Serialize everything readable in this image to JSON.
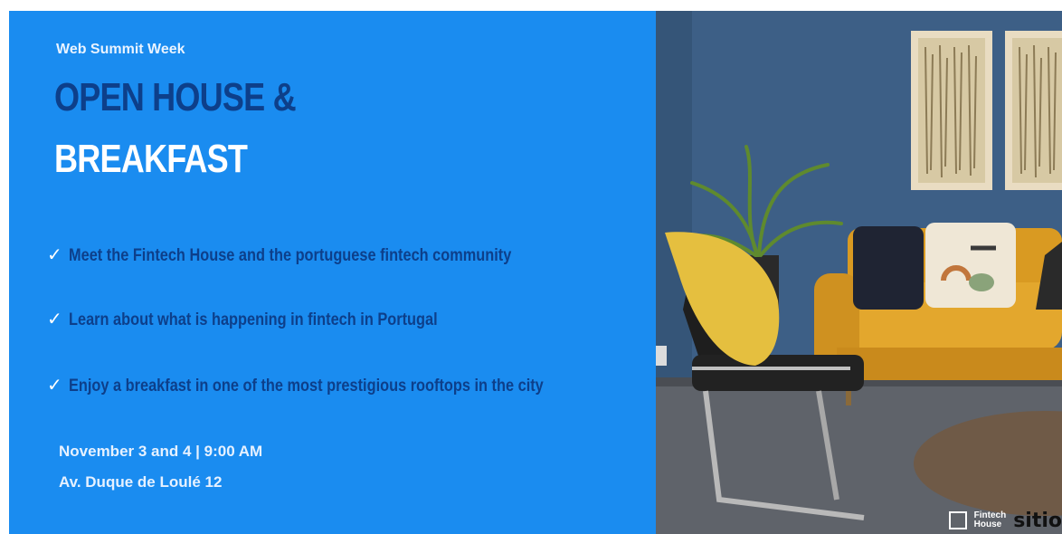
{
  "event": {
    "eyebrow": "Web Summit Week",
    "title_line1": "OPEN HOUSE &",
    "title_line2": "BREAKFAST",
    "bullets": [
      "Meet the Fintech House and the portuguese fintech community",
      "Learn about what is happening in fintech in Portugal",
      "Enjoy a breakfast in one of the most prestigious rooftops in the city"
    ],
    "check_glyph": "✓",
    "date_time": "November 3 and 4 | 9:00 AM",
    "address": "Av. Duque de Loulé 12"
  },
  "photo_logos": {
    "fintech_house_line1": "Fintech",
    "fintech_house_line2": "House",
    "partner": "sitio"
  },
  "colors": {
    "panel_blue": "#1a8cf0",
    "title_navy": "#0d3f8a",
    "wall_blue": "#3d5f86",
    "sofa_mustard": "#e3a72d"
  }
}
